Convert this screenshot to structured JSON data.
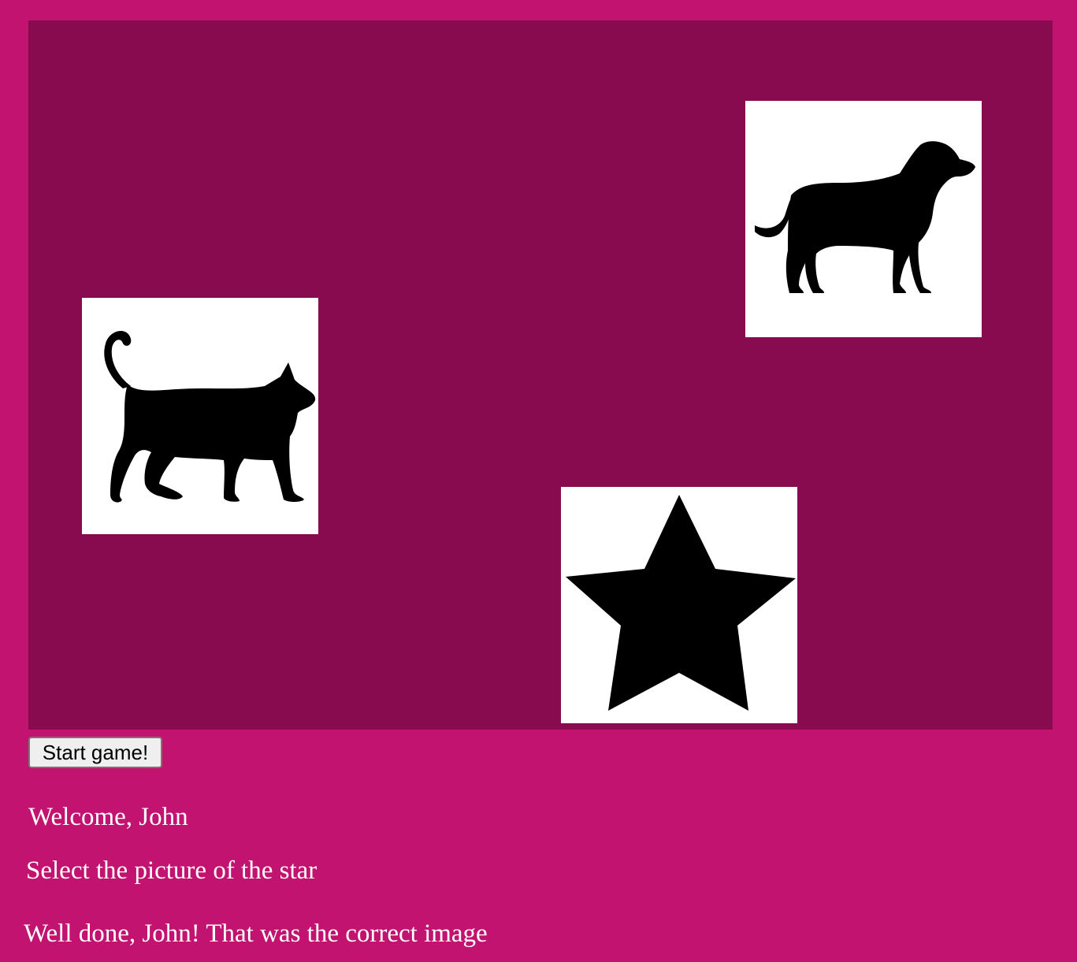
{
  "game": {
    "cards": [
      {
        "name": "cat",
        "icon": "cat-silhouette-icon"
      },
      {
        "name": "dog",
        "icon": "dog-silhouette-icon"
      },
      {
        "name": "star",
        "icon": "star-icon"
      }
    ],
    "start_button_label": "Start game!"
  },
  "messages": {
    "welcome": "Welcome, John",
    "instruction": "Select the picture of the star",
    "feedback": "Well done, John! That was the correct image"
  },
  "colors": {
    "page_background": "#c1136f",
    "board_background": "#880b4f",
    "card_background": "#ffffff",
    "text": "#ffffff"
  }
}
